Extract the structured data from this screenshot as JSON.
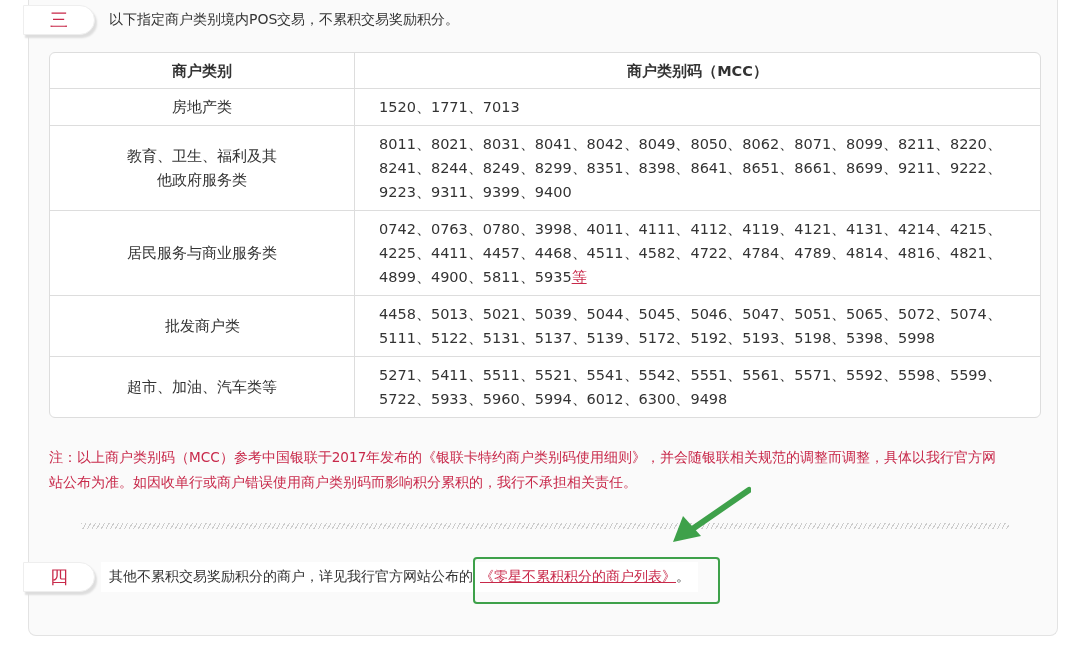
{
  "sections": [
    {
      "badge": "三",
      "text": "以下指定商户类别境内POS交易，不累积交易奖励积分。"
    }
  ],
  "table": {
    "columns": [
      "商户类别",
      "商户类别码（MCC）"
    ],
    "rows": [
      {
        "category": "房地产类",
        "codes": "1520、1771、7013"
      },
      {
        "category": "教育、卫生、福利及其他政府服务类",
        "codes": "8011、8021、8031、8041、8042、8049、8050、8062、8071、8099、8211、8220、8241、8244、8249、8299、8351、8398、8641、8651、8661、8699、9211、9222、9223、9311、9399、9400"
      },
      {
        "category": "居民服务与商业服务类",
        "codes": "0742、0763、0780、3998、4011、4111、4112、4119、4121、4131、4214、4215、4225、4411、4457、4468、4511、4582、4722、4784、4789、4814、4816、4821、4899、4900、5811、5935",
        "link": "等"
      },
      {
        "category": "批发商户类",
        "codes": "4458、5013、5021、5039、5044、5045、5046、5047、5051、5065、5072、5074、5111、5122、5131、5137、5139、5172、5192、5193、5198、5398、5998"
      },
      {
        "category": "超市、加油、汽车类等",
        "codes": "5271、5411、5511、5521、5541、5542、5551、5561、5571、5592、5598、5599、5722、5933、5960、5994、6012、6300、9498"
      }
    ]
  },
  "note": "注：以上商户类别码（MCC）参考中国银联于2017年发布的《银联卡特约商户类别码使用细则》，并会随银联相关规范的调整而调整，具体以我行官方网站公布为准。如因收单行或商户错误使用商户类别码而影响积分累积的，我行不承担相关责任。",
  "section_4": {
    "badge": "四",
    "text": "其他不累积交易奖励积分的商户，详见我行官方网站公布的",
    "link": "《零星不累积积分的商户列表》",
    "suffix": "。"
  }
}
